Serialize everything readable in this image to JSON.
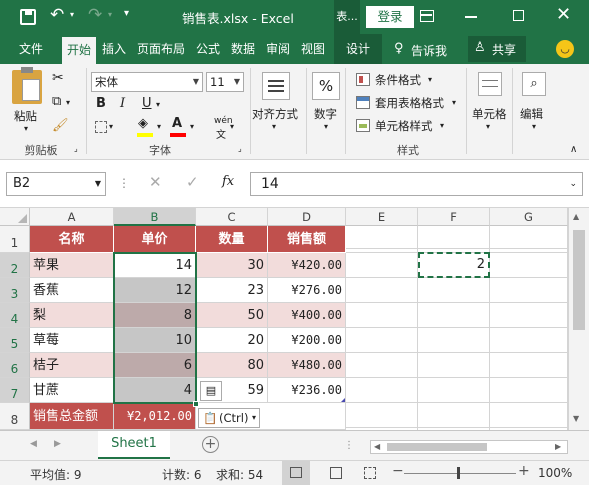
{
  "window": {
    "title": "销售表.xlsx - Excel",
    "context_tab": "表...",
    "login": "登录"
  },
  "tabs": [
    {
      "label": "文件"
    },
    {
      "label": "开始"
    },
    {
      "label": "插入"
    },
    {
      "label": "页面布局"
    },
    {
      "label": "公式"
    },
    {
      "label": "数据"
    },
    {
      "label": "审阅"
    },
    {
      "label": "视图"
    },
    {
      "label": "设计"
    }
  ],
  "tell_me": "告诉我",
  "share": "共享",
  "ribbon": {
    "clipboard": {
      "paste": "粘贴",
      "label": "剪贴板"
    },
    "font": {
      "name": "宋体",
      "size": "11",
      "bold": "B",
      "italic": "I",
      "underline": "U",
      "wen": "wén",
      "label": "字体"
    },
    "alignment": {
      "label": "对齐方式"
    },
    "number": {
      "label": "数字",
      "symbol": "%"
    },
    "styles": {
      "conditional": "条件格式",
      "table": "套用表格格式",
      "cell": "单元格样式",
      "label": "样式"
    },
    "cells": {
      "label": "单元格"
    },
    "editing": {
      "label": "编辑"
    }
  },
  "formula_bar": {
    "name_box": "B2",
    "fx": "fx",
    "value": "14"
  },
  "columns": [
    "A",
    "B",
    "C",
    "D",
    "E",
    "F",
    "G"
  ],
  "rows": [
    "1",
    "2",
    "3",
    "4",
    "5",
    "6",
    "7",
    "8"
  ],
  "table": {
    "headers": [
      "名称",
      "单价",
      "数量",
      "销售额"
    ],
    "rows": [
      [
        "苹果",
        "14",
        "30",
        "¥420.00"
      ],
      [
        "香蕉",
        "12",
        "23",
        "¥276.00"
      ],
      [
        "梨",
        "8",
        "50",
        "¥400.00"
      ],
      [
        "草莓",
        "10",
        "20",
        "¥200.00"
      ],
      [
        "桔子",
        "6",
        "80",
        "¥480.00"
      ],
      [
        "甘蔗",
        "4",
        "59",
        "¥236.00"
      ]
    ],
    "total_label": "销售总金额",
    "total_value": "¥2,012.00"
  },
  "copied_cell_value": "2",
  "paste_options_label": "(Ctrl)",
  "sheet_tab": "Sheet1",
  "status": {
    "average": "平均值: 9",
    "count": "计数: 6",
    "sum": "求和: 54",
    "zoom": "100%"
  },
  "colors": {
    "excel_green": "#217346",
    "header_fill": "#c0504d",
    "band_fill": "#f2dcdb",
    "selection_fill": "#c6c6c6"
  }
}
